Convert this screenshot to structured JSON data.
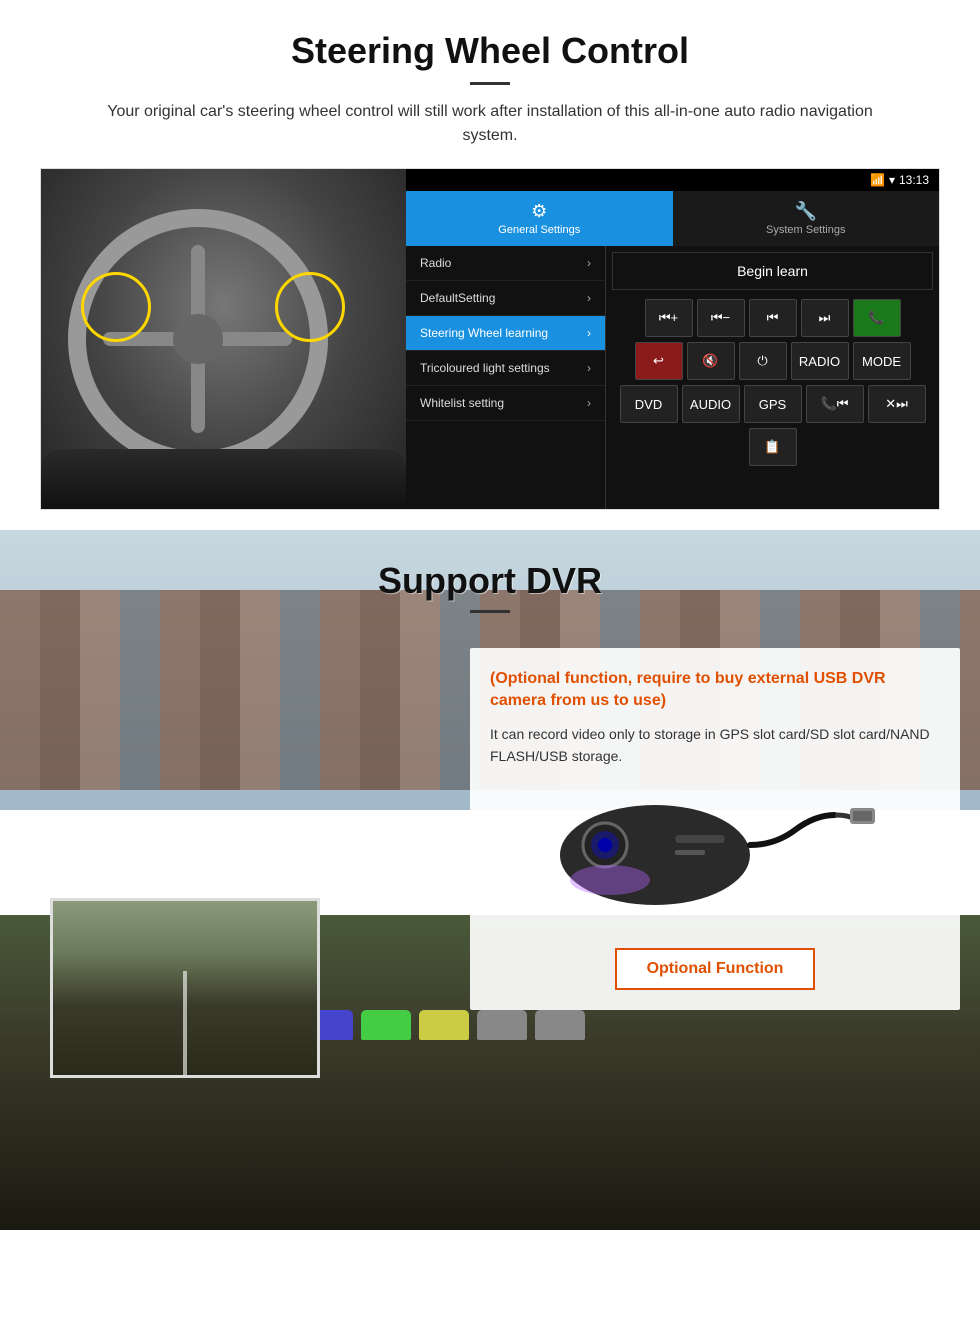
{
  "steering_section": {
    "title": "Steering Wheel Control",
    "description": "Your original car's steering wheel control will still work after installation of this all-in-one auto radio navigation system.",
    "statusbar": {
      "time": "13:13",
      "signal": "▾"
    },
    "tabs": [
      {
        "label": "General Settings",
        "icon": "⚙",
        "active": true
      },
      {
        "label": "System Settings",
        "icon": "🔧",
        "active": false
      }
    ],
    "menu_items": [
      {
        "label": "Radio",
        "active": false
      },
      {
        "label": "DefaultSetting",
        "active": false
      },
      {
        "label": "Steering Wheel learning",
        "active": true
      },
      {
        "label": "Tricoloured light settings",
        "active": false
      },
      {
        "label": "Whitelist setting",
        "active": false
      }
    ],
    "begin_learn_label": "Begin learn",
    "ctrl_buttons": [
      [
        "⏮+",
        "⏮−",
        "⏮⏮",
        "⏭⏭",
        "📞"
      ],
      [
        "↩",
        "🔇",
        "⏻",
        "RADIO",
        "MODE"
      ],
      [
        "DVD",
        "AUDIO",
        "GPS",
        "📞⏮",
        "✕⏭"
      ],
      [
        "📋"
      ]
    ]
  },
  "dvr_section": {
    "title": "Support DVR",
    "optional_note": "(Optional function, require to buy external USB DVR camera from us to use)",
    "description": "It can record video only to storage in GPS slot card/SD slot card/NAND FLASH/USB storage.",
    "optional_function_label": "Optional Function"
  }
}
